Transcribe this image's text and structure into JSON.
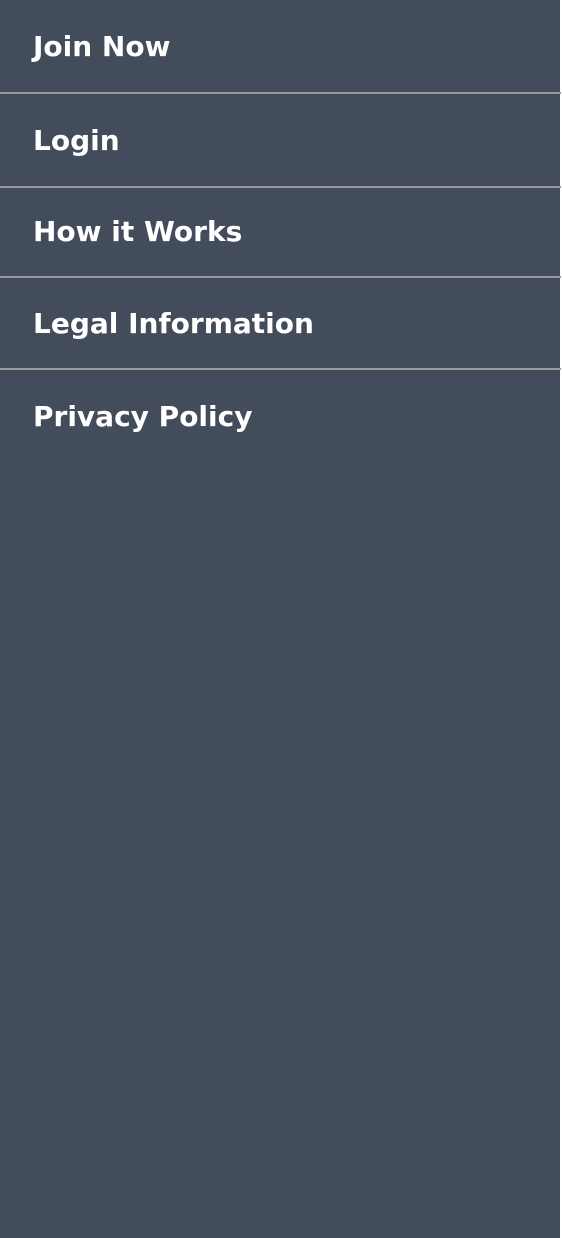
{
  "menu": {
    "items": [
      {
        "label": "Join Now"
      },
      {
        "label": "Login"
      },
      {
        "label": "How it Works"
      },
      {
        "label": "Legal Information"
      },
      {
        "label": "Privacy Policy"
      }
    ]
  },
  "colors": {
    "background": "#434c5a",
    "divider": "#9a9a9a",
    "text": "#ffffff"
  }
}
